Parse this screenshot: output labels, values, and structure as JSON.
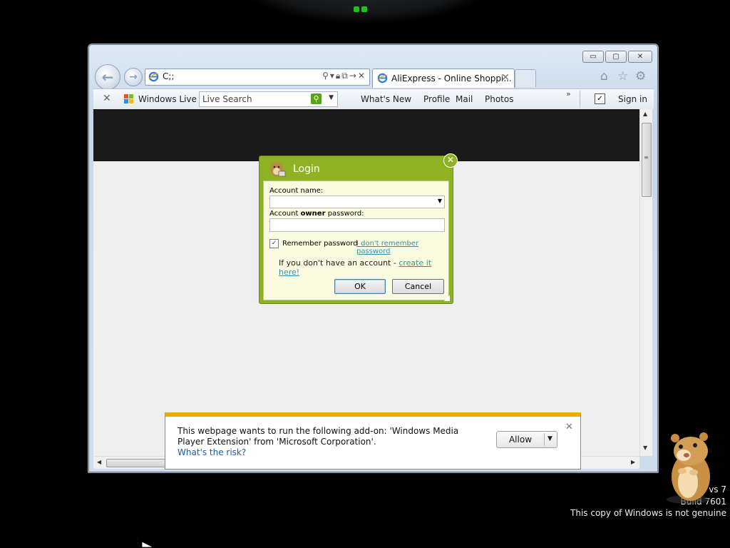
{
  "browser": {
    "address": "C;;",
    "tab_title": "AliExpress - Online Shoppi...",
    "tab_close": "✕",
    "window_buttons": {
      "minimize": "▭",
      "maximize": "▢",
      "close": "✕"
    }
  },
  "toolbar": {
    "close": "✕",
    "brand": "Windows Live",
    "search_placeholder": "Live Search",
    "links": [
      "What's New",
      "Profile",
      "Mail",
      "Photos"
    ],
    "more": "»",
    "sign_in": "Sign in"
  },
  "login": {
    "title": "Login",
    "account_label": "Account name:",
    "password_label_pre": "Account ",
    "password_label_bold": "owner",
    "password_label_post": " password:",
    "remember_label": "Remember password",
    "remember_checked": true,
    "forgot_link": "I don't remember password",
    "signup_text": "If you don't have an account - ",
    "signup_link": "create it here!",
    "ok": "OK",
    "cancel": "Cancel"
  },
  "notification": {
    "message": "This webpage wants to run the following add-on: 'Windows Media Player Extension' from 'Microsoft Corporation'.",
    "risk_link": "What's the risk?",
    "allow": "Allow"
  },
  "watermark": {
    "line1": "vs 7",
    "line2": "Build 7601",
    "line3": "This copy of Windows is not genuine"
  },
  "colors": {
    "dialog_green": "#8fb222",
    "dialog_body": "#fbfbe1",
    "notify_accent": "#f2a900",
    "link": "#1d5aa8"
  },
  "icons": [
    "back-icon",
    "forward-icon",
    "ie-icon",
    "search-icon",
    "lock-icon",
    "refresh-icon",
    "stop-icon",
    "home-icon",
    "star-icon",
    "gear-icon",
    "windows-live-flag-icon",
    "hamster-mascot"
  ]
}
